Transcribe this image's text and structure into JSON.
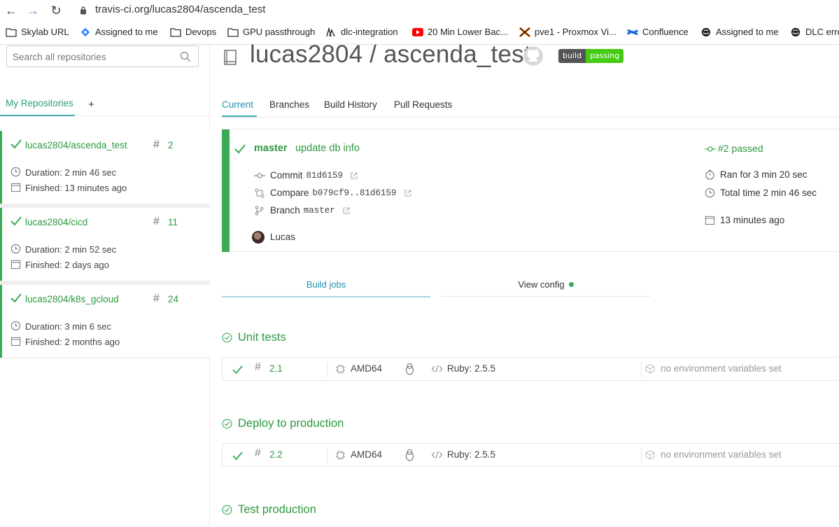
{
  "browser": {
    "url": "travis-ci.org/lucas2804/ascenda_test",
    "bookmarks": [
      {
        "label": "Skylab URL",
        "icon": "folder-icon"
      },
      {
        "label": "Assigned to me",
        "icon": "jira-icon"
      },
      {
        "label": "Devops",
        "icon": "folder-icon"
      },
      {
        "label": "GPU passthrough",
        "icon": "folder-icon"
      },
      {
        "label": "dlc-integration",
        "icon": "gitlab-icon"
      },
      {
        "label": "20 Min Lower Bac...",
        "icon": "youtube-icon"
      },
      {
        "label": "pve1 - Proxmox Vi...",
        "icon": "proxmox-icon"
      },
      {
        "label": "Confluence",
        "icon": "confluence-icon"
      },
      {
        "label": "Assigned to me",
        "icon": "globe-icon"
      },
      {
        "label": "DLC erro",
        "icon": "globe-icon"
      }
    ]
  },
  "sidebar": {
    "search_placeholder": "Search all repositories",
    "tab_label": "My Repositories",
    "add_label": "+",
    "repos": [
      {
        "name": "lucas2804/ascenda_test",
        "build_number": "2",
        "duration": "Duration: 2 min 46 sec",
        "finished": "Finished: 13 minutes ago"
      },
      {
        "name": "lucas2804/cicd",
        "build_number": "11",
        "duration": "Duration: 2 min 52 sec",
        "finished": "Finished: 2 days ago"
      },
      {
        "name": "lucas2804/k8s_gcloud",
        "build_number": "24",
        "duration": "Duration: 3 min 6 sec",
        "finished": "Finished: 2 months ago"
      }
    ]
  },
  "main": {
    "title": "lucas2804 / ascenda_test",
    "badge": {
      "left": "build",
      "right": "passing"
    },
    "tabs": [
      "Current",
      "Branches",
      "Build History",
      "Pull Requests"
    ],
    "build": {
      "branch": "master",
      "message": "update db info",
      "status": "#2 passed",
      "commit_label": "Commit",
      "commit": "81d6159",
      "compare_label": "Compare",
      "compare": "b079cf9..81d6159",
      "branch_label": "Branch",
      "branch_value": "master",
      "author": "Lucas",
      "ran_for": "Ran for 3 min 20 sec",
      "total_time": "Total time 2 min 46 sec",
      "finished": "13 minutes ago"
    },
    "subtabs": {
      "jobs": "Build jobs",
      "config": "View config"
    },
    "stages": [
      {
        "name": "Unit tests",
        "job": {
          "number": "2.1",
          "arch": "AMD64",
          "language": "Ruby: 2.5.5",
          "env": "no environment variables set"
        }
      },
      {
        "name": "Deploy to production",
        "job": {
          "number": "2.2",
          "arch": "AMD64",
          "language": "Ruby: 2.5.5",
          "env": "no environment variables set"
        }
      },
      {
        "name": "Test production"
      }
    ]
  },
  "colors": {
    "success": "#39aa56",
    "link": "#2b9a3e",
    "accent": "#3eaaaf"
  }
}
